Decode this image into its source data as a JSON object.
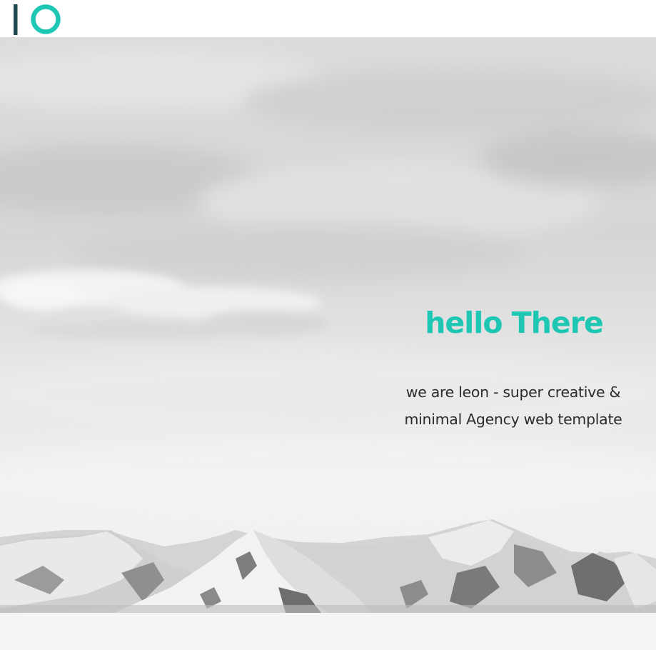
{
  "brand": {
    "logo_icon": "io-logo-icon",
    "accent_color": "#1ec6b4",
    "bar_color": "#1f4b52"
  },
  "hero": {
    "title": "hello There",
    "subtitle_line1": "we are leon - super creative &",
    "subtitle_line2": "minimal Agency web template",
    "title_color": "#1ec6b4",
    "background_image": "snowy-mountains-clouds-image"
  }
}
